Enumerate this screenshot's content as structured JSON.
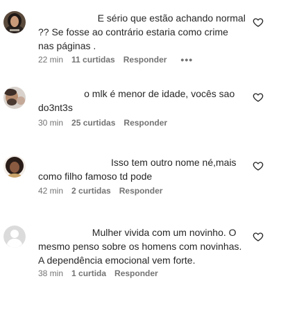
{
  "comments": [
    {
      "text": "                      E sério que estão achando normal ?? Se fosse ao contrário estaria como crime nas páginas .",
      "time": "22 min",
      "likes": "11 curtidas",
      "reply": "Responder",
      "more": "•••",
      "avatar": "user-avatar-dark-hair"
    },
    {
      "text": "                 o mlk é menor de idade, vocês sao do3nt3s",
      "time": "30 min",
      "likes": "25 curtidas",
      "reply": "Responder",
      "avatar": "user-avatar-man-beard"
    },
    {
      "text": "                           Isso tem outro nome né,mais como filho famoso td pode",
      "time": "42 min",
      "likes": "2 curtidas",
      "reply": "Responder",
      "avatar": "user-avatar-curly-hair"
    },
    {
      "text": "                    Mulher vivida com um novinho. O mesmo penso sobre os homens com novinhas. A dependência emocional vem forte.",
      "time": "38 min",
      "likes": "1 curtida",
      "reply": "Responder",
      "avatar": "default-user-avatar"
    }
  ],
  "colors": {
    "text": "#262626",
    "meta": "#737373",
    "background": "#ffffff"
  },
  "icons": {
    "like": "heart-outline-icon"
  }
}
